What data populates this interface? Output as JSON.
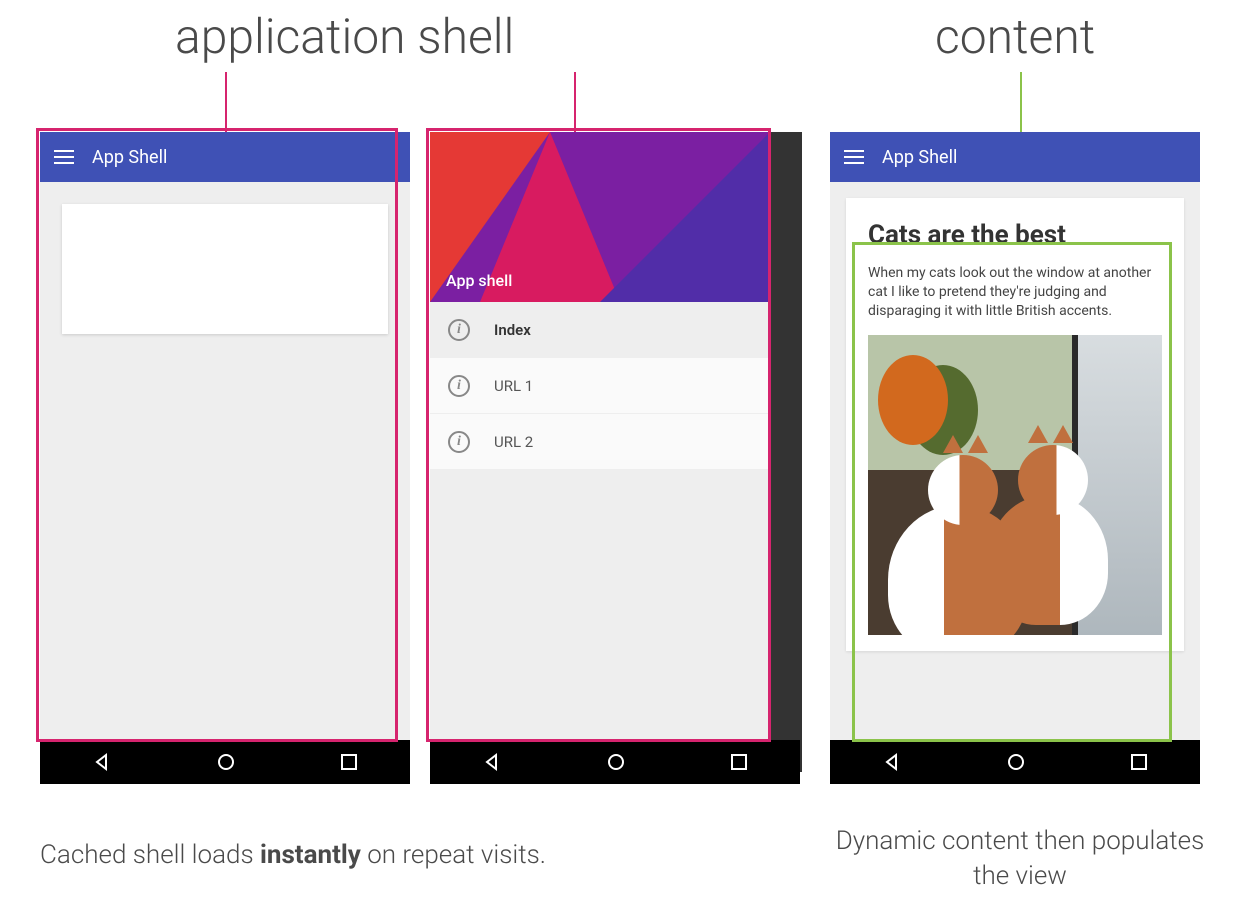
{
  "headings": {
    "shell": "application shell",
    "content": "content"
  },
  "appbar_title": "App Shell",
  "drawer": {
    "header_label": "App shell",
    "items": [
      {
        "label": "Index",
        "active": true
      },
      {
        "label": "URL 1",
        "active": false
      },
      {
        "label": "URL 2",
        "active": false
      }
    ]
  },
  "article": {
    "title": "Cats are the best",
    "body": "When my cats look out the window at another cat I like to pretend they're judging and disparaging it with little British accents."
  },
  "captions": {
    "left_pre": "Cached shell loads ",
    "left_bold": "instantly",
    "left_post": " on repeat visits.",
    "right": "Dynamic content then populates the view"
  }
}
